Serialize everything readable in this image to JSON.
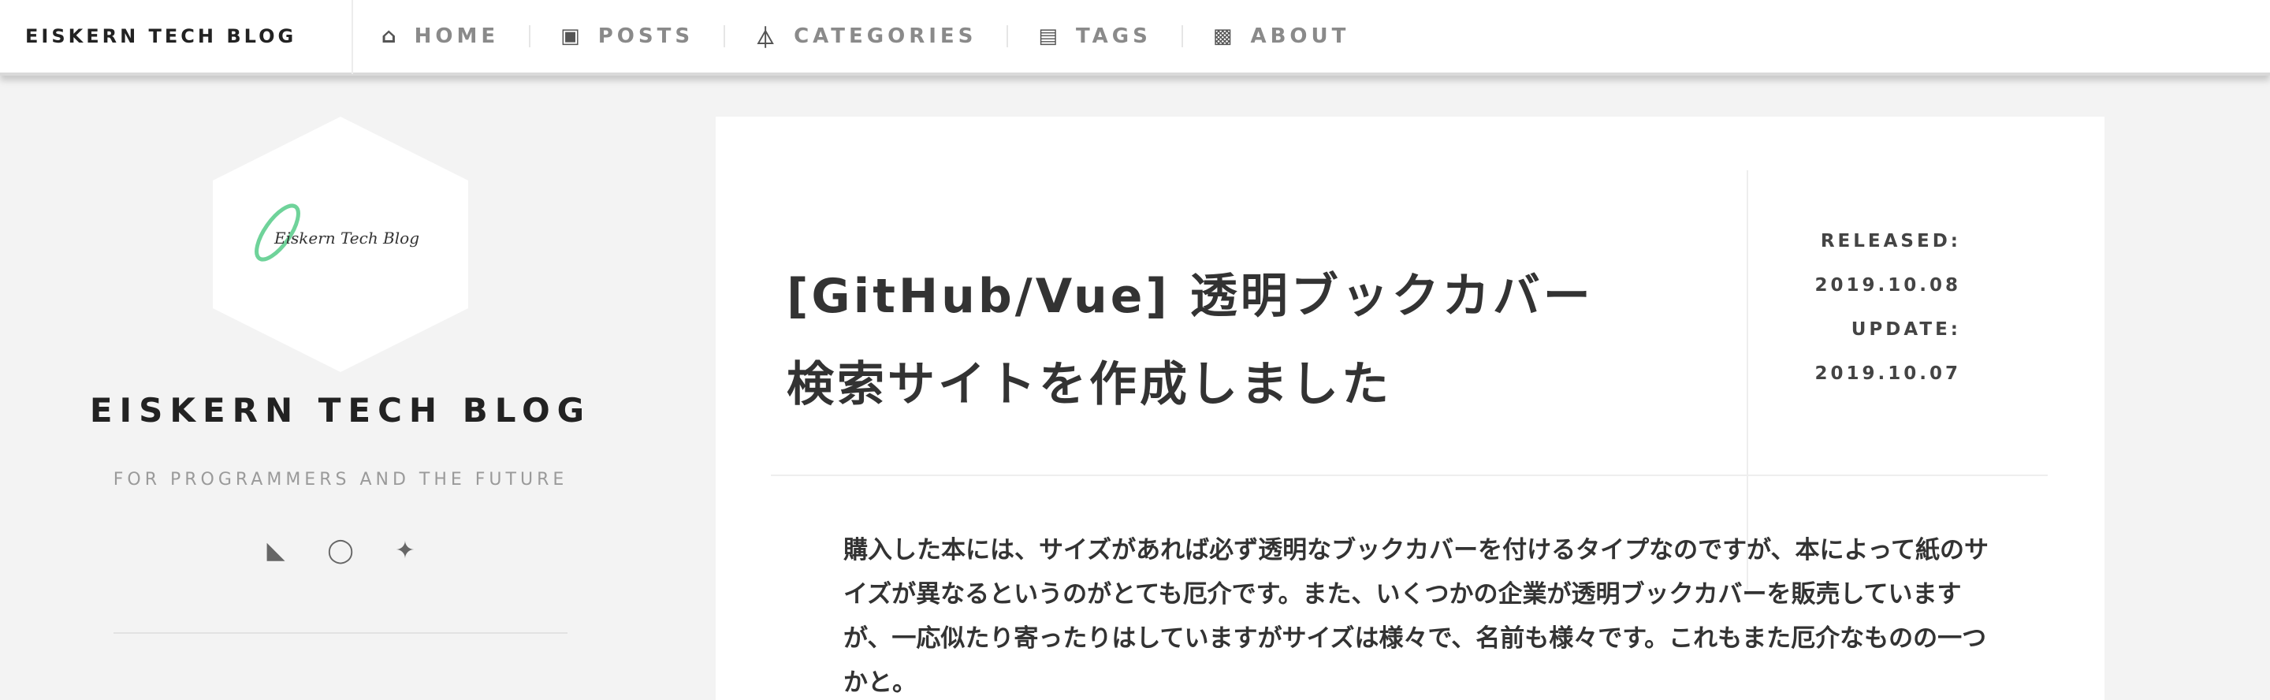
{
  "navbar": {
    "brand": "EISKERN TECH BLOG",
    "items": [
      {
        "icon": "home-icon",
        "glyph": "⌂",
        "label": "HOME"
      },
      {
        "icon": "posts-icon",
        "glyph": "▣",
        "label": "POSTS"
      },
      {
        "icon": "categories-icon",
        "glyph": "⏃",
        "label": "CATEGORIES"
      },
      {
        "icon": "tags-icon",
        "glyph": "▤",
        "label": "TAGS"
      },
      {
        "icon": "about-icon",
        "glyph": "▩",
        "label": "ABOUT"
      }
    ]
  },
  "sidebar": {
    "logo_text": "Eiskern Tech Blog",
    "title": "EISKERN TECH BLOG",
    "subtitle": "FOR PROGRAMMERS AND THE FUTURE",
    "social": [
      {
        "icon": "rss-icon",
        "glyph": "◣"
      },
      {
        "icon": "github-icon",
        "glyph": "◯"
      },
      {
        "icon": "twitter-icon",
        "glyph": "✦"
      }
    ]
  },
  "post": {
    "title": "[GitHub/Vue] 透明ブックカバー検索サイトを作成しました",
    "meta": {
      "released_label": "RELEASED:",
      "released_date": "2019.10.08",
      "update_label": "UPDATE:",
      "update_date": "2019.10.07"
    },
    "body": "購入した本には、サイズがあれば必ず透明なブックカバーを付けるタイプなのですが、本によって紙のサイズが異なるというのがとても厄介です。また、いくつかの企業が透明ブックカバーを販売していますが、一応似たり寄ったりはしていますがサイズは様々で、名前も様々です。これもまた厄介なものの一つかと。"
  },
  "colors": {
    "background": "#f3f3f3",
    "card": "#ffffff",
    "logo_accent": "#6fd39a"
  }
}
